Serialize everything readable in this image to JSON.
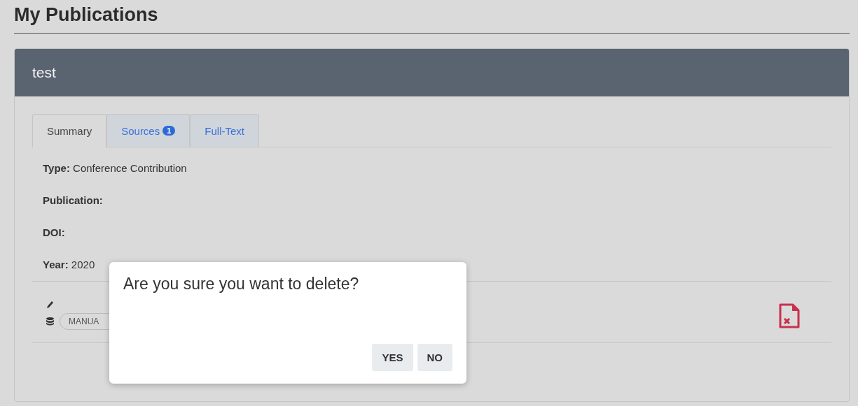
{
  "page_title": "My Publications",
  "card": {
    "title": "test",
    "tabs": [
      {
        "label": "Summary",
        "selected": true
      },
      {
        "label": "Sources",
        "badge": "1",
        "selected": false
      },
      {
        "label": "Full-Text",
        "selected": false
      }
    ],
    "fields": [
      {
        "label": "Type:",
        "value": "Conference Contribution"
      },
      {
        "label": "Publication:"
      },
      {
        "label": "DOI:"
      },
      {
        "label": "Year:",
        "value": "2020"
      }
    ],
    "source_chip": "MANUA"
  },
  "dialog": {
    "message": "Are you sure you want to delete?",
    "buttons": [
      "YES",
      "NO"
    ]
  }
}
